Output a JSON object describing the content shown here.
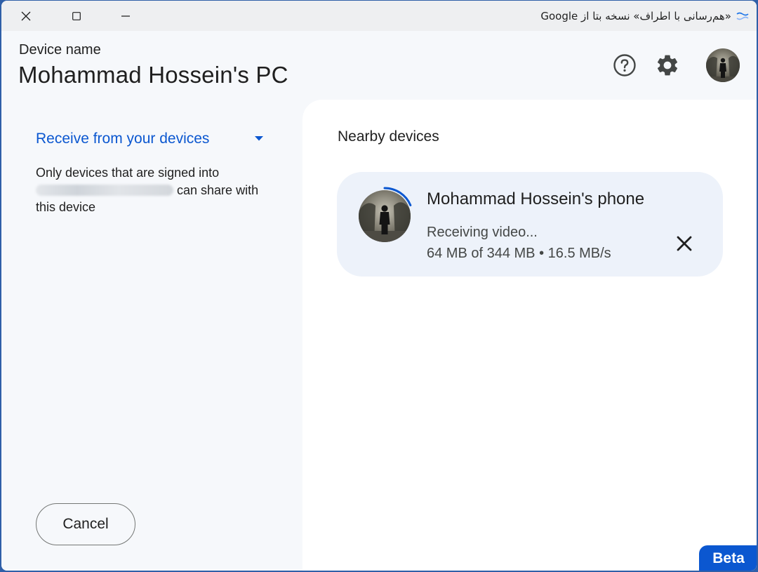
{
  "window": {
    "title": "«هم‌رسانی با اطراف» نسخه بتا از Google",
    "app_icon": "nearby-share-icon",
    "controls": [
      "close-icon",
      "maximize-icon",
      "minimize-icon"
    ]
  },
  "header": {
    "device_label": "Device name",
    "device_name": "Mohammad Hossein's PC",
    "help_icon": "help-circle-icon",
    "settings_icon": "gear-icon"
  },
  "left": {
    "receive_label": "Receive from your devices",
    "info_prefix": "Only devices that are signed into",
    "info_suffix": "can share with this device",
    "cancel_label": "Cancel"
  },
  "right": {
    "nearby_title": "Nearby devices",
    "device": {
      "name": "Mohammad Hossein's phone",
      "status": "Receiving video...",
      "progress_text": "64 MB of 344 MB • 16.5 MB/s",
      "progress_fraction": 0.186
    }
  },
  "badge": "Beta",
  "colors": {
    "accent": "#0b57d0",
    "card_bg": "#edf2fa",
    "pane_bg": "#f6f8fb"
  }
}
